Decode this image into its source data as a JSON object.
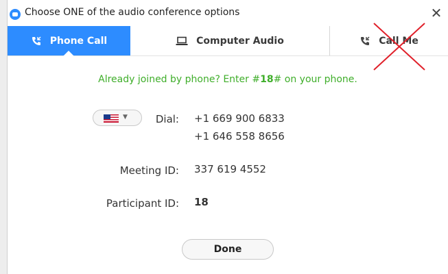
{
  "window": {
    "title": "Choose ONE of the audio conference options",
    "close_glyph": "✕"
  },
  "tabs": [
    {
      "label": "Phone Call",
      "icon": "phone-icon",
      "active": true
    },
    {
      "label": "Computer Audio",
      "icon": "laptop-icon",
      "active": false
    },
    {
      "label": "Call Me",
      "icon": "phone-icon",
      "active": false
    }
  ],
  "notice": {
    "prefix": "Already joined by phone? Enter #",
    "code": "18",
    "suffix": "# on your phone."
  },
  "dial": {
    "label": "Dial:",
    "numbers": [
      "+1 669 900 6833",
      "+1 646 558 8656"
    ],
    "country_icon": "us-flag-icon"
  },
  "meeting": {
    "label": "Meeting ID:",
    "value": "337 619 4552"
  },
  "participant": {
    "label": "Participant ID:",
    "value": "18"
  },
  "done_label": "Done",
  "colors": {
    "accent": "#2d8cff",
    "notice_green": "#3fae2a",
    "annotation_red": "#e0202a"
  }
}
